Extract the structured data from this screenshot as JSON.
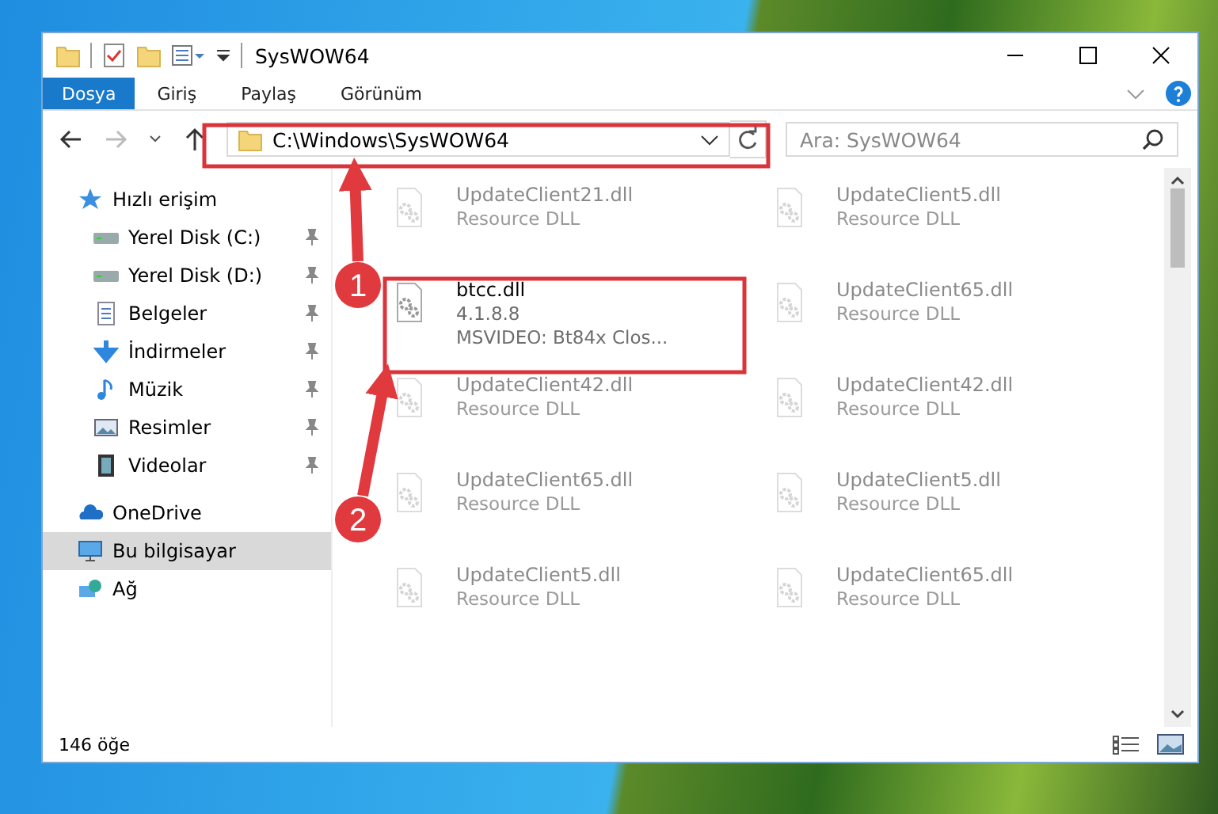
{
  "window": {
    "title": "SysWOW64"
  },
  "ribbon_tabs": [
    {
      "label": "Dosya",
      "kind": "file"
    },
    {
      "label": "Giriş",
      "kind": "tab"
    },
    {
      "label": "Paylaş",
      "kind": "tab"
    },
    {
      "label": "Görünüm",
      "kind": "tab"
    }
  ],
  "address": {
    "path": "C:\\Windows\\SysWOW64",
    "search_placeholder": "Ara: SysWOW64"
  },
  "sidebar": {
    "items": [
      {
        "label": "Hızlı erişim",
        "kind": "star",
        "selected": false,
        "children": [
          {
            "label": "Yerel Disk (C:)",
            "kind": "drive",
            "pinned": true
          },
          {
            "label": "Yerel Disk (D:)",
            "kind": "drive",
            "pinned": true
          },
          {
            "label": "Belgeler",
            "kind": "doc",
            "pinned": true
          },
          {
            "label": "İndirmeler",
            "kind": "down",
            "pinned": true
          },
          {
            "label": "Müzik",
            "kind": "music",
            "pinned": true
          },
          {
            "label": "Resimler",
            "kind": "picture",
            "pinned": true
          },
          {
            "label": "Videolar",
            "kind": "film",
            "pinned": true
          }
        ]
      },
      {
        "label": "OneDrive",
        "kind": "cloud",
        "selected": false
      },
      {
        "label": "Bu bilgisayar",
        "kind": "monitor",
        "selected": true
      },
      {
        "label": "Ağ",
        "kind": "network",
        "selected": false
      }
    ]
  },
  "files": [
    {
      "name": "UpdateClient21.dll",
      "details": [
        "Resource DLL"
      ],
      "faded": true
    },
    {
      "name": "UpdateClient5.dll",
      "details": [
        "Resource DLL"
      ],
      "faded": true
    },
    {
      "name": "btcc.dll",
      "details": [
        "4.1.8.8",
        "MSVIDEO: Bt84x Clos..."
      ],
      "faded": false
    },
    {
      "name": "UpdateClient65.dll",
      "details": [
        "Resource DLL"
      ],
      "faded": true
    },
    {
      "name": "UpdateClient42.dll",
      "details": [
        "Resource DLL"
      ],
      "faded": true
    },
    {
      "name": "UpdateClient42.dll",
      "details": [
        "Resource DLL"
      ],
      "faded": true
    },
    {
      "name": "UpdateClient65.dll",
      "details": [
        "Resource DLL"
      ],
      "faded": true
    },
    {
      "name": "UpdateClient5.dll",
      "details": [
        "Resource DLL"
      ],
      "faded": true
    },
    {
      "name": "UpdateClient5.dll",
      "details": [
        "Resource DLL"
      ],
      "faded": true
    },
    {
      "name": "UpdateClient65.dll",
      "details": [
        "Resource DLL"
      ],
      "faded": true
    }
  ],
  "status_bar": {
    "count": "146 öğe"
  },
  "annotations": [
    {
      "number": "1"
    },
    {
      "number": "2"
    }
  ]
}
